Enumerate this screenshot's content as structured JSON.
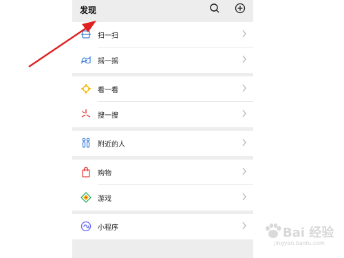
{
  "header": {
    "title": "发现"
  },
  "groups": [
    [
      {
        "label": "扫一扫"
      },
      {
        "label": "摇一摇"
      }
    ],
    [
      {
        "label": "看一看"
      },
      {
        "label": "搜一搜"
      }
    ],
    [
      {
        "label": "附近的人"
      }
    ],
    [
      {
        "label": "购物"
      },
      {
        "label": "游戏"
      }
    ],
    [
      {
        "label": "小程序"
      }
    ]
  ],
  "watermark": {
    "text": "Bai 经验",
    "url": "jingyan.baidu.com"
  },
  "colors": {
    "background": "#ededed",
    "arrow": "#e02020",
    "scan": "#3b7ddd",
    "shake": "#3b7ddd",
    "look": "#f5b800",
    "search": "#e64340",
    "nearby": "#3b7ddd",
    "shop": "#e64340",
    "game": "#2aae67",
    "miniprogram": "#6467f0"
  }
}
